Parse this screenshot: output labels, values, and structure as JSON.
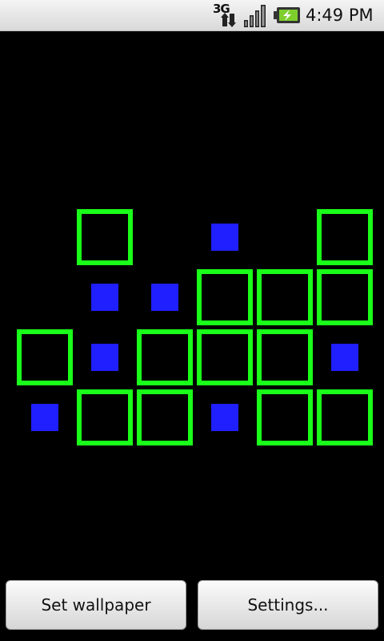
{
  "status_bar": {
    "network_label": "3G",
    "time": "4:49 PM",
    "icons": [
      "3g-data-icon",
      "signal-strength-icon",
      "battery-charging-icon"
    ]
  },
  "wallpaper": {
    "outline_color": "#1aff1a",
    "fill_color": "#1f1fff",
    "background_color": "#000000",
    "columns": 6,
    "rows": [
      [
        "empty",
        "outline",
        "empty",
        "filled",
        "empty",
        "outline"
      ],
      [
        "empty",
        "filled",
        "filled",
        "outline",
        "outline",
        "outline"
      ],
      [
        "outline",
        "filled",
        "outline",
        "outline",
        "outline",
        "filled"
      ],
      [
        "filled",
        "outline",
        "outline",
        "filled",
        "outline",
        "outline"
      ]
    ]
  },
  "buttons": {
    "set_wallpaper": "Set wallpaper",
    "settings": "Settings..."
  }
}
